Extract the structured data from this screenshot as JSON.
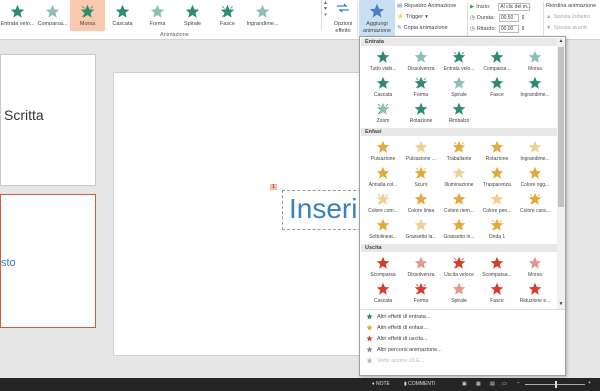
{
  "ribbon": {
    "gallery": [
      {
        "label": "Entrata velo...",
        "icon": "entrata-veloce-star-icon"
      },
      {
        "label": "Comparsa...",
        "icon": "comparsa-star-icon"
      },
      {
        "label": "Morsa",
        "icon": "morsa-star-icon",
        "selected": true
      },
      {
        "label": "Cascata",
        "icon": "cascata-star-icon"
      },
      {
        "label": "Forma",
        "icon": "forma-star-icon"
      },
      {
        "label": "Spirale",
        "icon": "spirale-star-icon"
      },
      {
        "label": "Fasce",
        "icon": "fasce-star-icon"
      },
      {
        "label": "Ingrandime...",
        "icon": "ingrandimento-star-icon"
      }
    ],
    "opzioni_effetto": "Opzioni effetto",
    "aggiungi_animazione": "Aggiungi animazione",
    "riquadro_animazione": "Riquadro Animazione",
    "trigger": "Trigger",
    "copia_animazione": "Copia animazione",
    "inizio_label": "Inizio:",
    "inizio_value": "Al clic del m...",
    "durata_label": "Durata:",
    "durata_value": "00,50",
    "ritardo_label": "Ritardo:",
    "ritardo_value": "00,00",
    "riordina": "Riordina animazione",
    "sposta_indietro": "Sposta indietro",
    "sposta_avanti": "Sposta avanti",
    "group_animazione": "Animazione"
  },
  "slides": {
    "thumb1_text": "Scritta",
    "thumb2_text": "sto"
  },
  "canvas": {
    "placeholder_text": "Inserir",
    "anim_tag": "1"
  },
  "menu": {
    "sections": [
      {
        "title": "Entrata",
        "color": "#2e8b6e",
        "items": [
          "Tutto visib...",
          "Dissolvenza",
          "Entrata velo...",
          "Comparsa...",
          "Morsa",
          "Cascata",
          "Forma",
          "Spirale",
          "Fasce",
          "Ingrandime...",
          "Zoom",
          "Rotazione",
          "Rimbalzo"
        ]
      },
      {
        "title": "Enfasi",
        "color": "#e3a93d",
        "items": [
          "Pulsazione",
          "Pulsazione ...",
          "Traballante",
          "Rotazione",
          "Ingrandime...",
          "Annulla col...",
          "Scuro",
          "Illuminazione",
          "Trasparenza",
          "Colore ogg...",
          "Colore com...",
          "Colore linea",
          "Colore riem...",
          "Colore pen...",
          "Colore cara...",
          "Sottolineat...",
          "Grassetto la...",
          "Grassetto in...",
          "Onda 1"
        ]
      },
      {
        "title": "Uscita",
        "color": "#d5402c",
        "items": [
          "Scomparsa",
          "Dissolvenza",
          "Uscita veloce",
          "Scomparsa...",
          "Morsa",
          "Cascata",
          "Forma",
          "Spirale",
          "Fasce",
          "Riduzione e..."
        ]
      }
    ],
    "links": [
      {
        "label": "Altri effetti di entrata...",
        "color": "#2e8b6e"
      },
      {
        "label": "Altri effetti di enfasi...",
        "color": "#e3a93d"
      },
      {
        "label": "Altri effetti di uscita...",
        "color": "#d5402c"
      },
      {
        "label": "Altri percorsi animazione...",
        "color": "#888888"
      },
      {
        "label": "Verbi azione OLE...",
        "color": "#bbbbbb"
      }
    ]
  },
  "status": {
    "note": "NOTE",
    "commenti": "COMMENTI"
  }
}
